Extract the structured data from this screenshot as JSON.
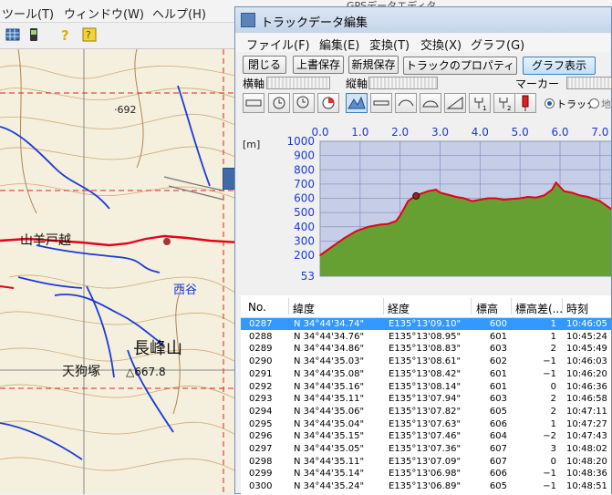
{
  "bg_app": {
    "menu": [
      "ツール(T)",
      "ウィンドウ(W)",
      "ヘルプ(H)"
    ],
    "behind_title": "GPSデータエディタ"
  },
  "map": {
    "labels": {
      "elev_692": "·692",
      "pass_name": "山羊戸越",
      "valley": "西谷",
      "mountain": "長峰山",
      "tengu": "天狗塚",
      "tengu_elev": "△667.8"
    }
  },
  "window": {
    "title": "トラックデータ編集",
    "menu": [
      "ファイル(F)",
      "編集(E)",
      "変換(T)",
      "交換(X)",
      "グラフ(G)"
    ],
    "buttons": {
      "close": "閉じる",
      "overwrite": "上書保存",
      "save_new": "新規保存",
      "properties": "トラックのプロパティ",
      "graph_view": "グラフ表示"
    },
    "labels": {
      "h_axis": "横軸",
      "v_axis": "縦軸",
      "marker": "マーカー",
      "radio_track": "トラック",
      "radio_map": "地"
    }
  },
  "chart_data": {
    "type": "area",
    "x_ticks": [
      "0.0",
      "1.0",
      "2.0",
      "3.0",
      "4.0",
      "5.0",
      "6.0",
      "7.0"
    ],
    "y_ticks": [
      "1000",
      "900",
      "800",
      "700",
      "600",
      "500",
      "400",
      "300",
      "200",
      "53"
    ],
    "ylabel": "[m]",
    "xlim": [
      0,
      7.3
    ],
    "ylim": [
      53,
      1000
    ],
    "fill_color": "#66a032",
    "line_color": "#e8001a",
    "plot_bg": "#c6cde6",
    "x": [
      0.0,
      0.3,
      0.6,
      0.9,
      1.2,
      1.5,
      1.7,
      1.9,
      2.0,
      2.1,
      2.2,
      2.35,
      2.5,
      2.7,
      2.9,
      3.0,
      3.2,
      3.4,
      3.6,
      3.8,
      4.0,
      4.2,
      4.4,
      4.6,
      4.8,
      5.0,
      5.2,
      5.4,
      5.6,
      5.8,
      5.9,
      6.0,
      6.1,
      6.3,
      6.5,
      6.7,
      6.9,
      7.0,
      7.3
    ],
    "y": [
      200,
      260,
      320,
      370,
      400,
      415,
      420,
      440,
      480,
      530,
      580,
      610,
      630,
      650,
      660,
      640,
      625,
      610,
      600,
      580,
      590,
      600,
      600,
      590,
      595,
      600,
      610,
      605,
      620,
      660,
      710,
      680,
      650,
      640,
      620,
      610,
      590,
      580,
      520
    ],
    "cursor_x": 2.4
  },
  "table": {
    "columns": [
      "No.",
      "緯度",
      "経度",
      "標高",
      "標高差(...",
      "時刻"
    ],
    "rows": [
      {
        "no": "0287",
        "lat": "N 34°44'34.74\"",
        "lon": "E135°13'09.10\"",
        "elev": "600",
        "diff": "1",
        "time": "10:46:05",
        "selected": true
      },
      {
        "no": "0288",
        "lat": "N 34°44'34.76\"",
        "lon": "E135°13'08.95\"",
        "elev": "601",
        "diff": "1",
        "time": "10:45:24",
        "selected": false
      },
      {
        "no": "0289",
        "lat": "N 34°44'34.86\"",
        "lon": "E135°13'08.83\"",
        "elev": "603",
        "diff": "2",
        "time": "10:45:49",
        "selected": false
      },
      {
        "no": "0290",
        "lat": "N 34°44'35.03\"",
        "lon": "E135°13'08.61\"",
        "elev": "602",
        "diff": "−1",
        "time": "10:46:03",
        "selected": false
      },
      {
        "no": "0291",
        "lat": "N 34°44'35.08\"",
        "lon": "E135°13'08.42\"",
        "elev": "601",
        "diff": "−1",
        "time": "10:46:20",
        "selected": false
      },
      {
        "no": "0292",
        "lat": "N 34°44'35.16\"",
        "lon": "E135°13'08.14\"",
        "elev": "601",
        "diff": "0",
        "time": "10:46:36",
        "selected": false
      },
      {
        "no": "0293",
        "lat": "N 34°44'35.11\"",
        "lon": "E135°13'07.94\"",
        "elev": "603",
        "diff": "2",
        "time": "10:46:58",
        "selected": false
      },
      {
        "no": "0294",
        "lat": "N 34°44'35.06\"",
        "lon": "E135°13'07.82\"",
        "elev": "605",
        "diff": "2",
        "time": "10:47:11",
        "selected": false
      },
      {
        "no": "0295",
        "lat": "N 34°44'35.04\"",
        "lon": "E135°13'07.63\"",
        "elev": "606",
        "diff": "1",
        "time": "10:47:27",
        "selected": false
      },
      {
        "no": "0296",
        "lat": "N 34°44'35.15\"",
        "lon": "E135°13'07.46\"",
        "elev": "604",
        "diff": "−2",
        "time": "10:47:43",
        "selected": false
      },
      {
        "no": "0297",
        "lat": "N 34°44'35.05\"",
        "lon": "E135°13'07.36\"",
        "elev": "607",
        "diff": "3",
        "time": "10:48:02",
        "selected": false
      },
      {
        "no": "0298",
        "lat": "N 34°44'35.11\"",
        "lon": "E135°13'07.09\"",
        "elev": "607",
        "diff": "0",
        "time": "10:48:20",
        "selected": false
      },
      {
        "no": "0299",
        "lat": "N 34°44'35.14\"",
        "lon": "E135°13'06.98\"",
        "elev": "606",
        "diff": "−1",
        "time": "10:48:36",
        "selected": false
      },
      {
        "no": "0300",
        "lat": "N 34°44'35.24\"",
        "lon": "E135°13'06.89\"",
        "elev": "605",
        "diff": "−1",
        "time": "10:48:51",
        "selected": false
      }
    ]
  }
}
